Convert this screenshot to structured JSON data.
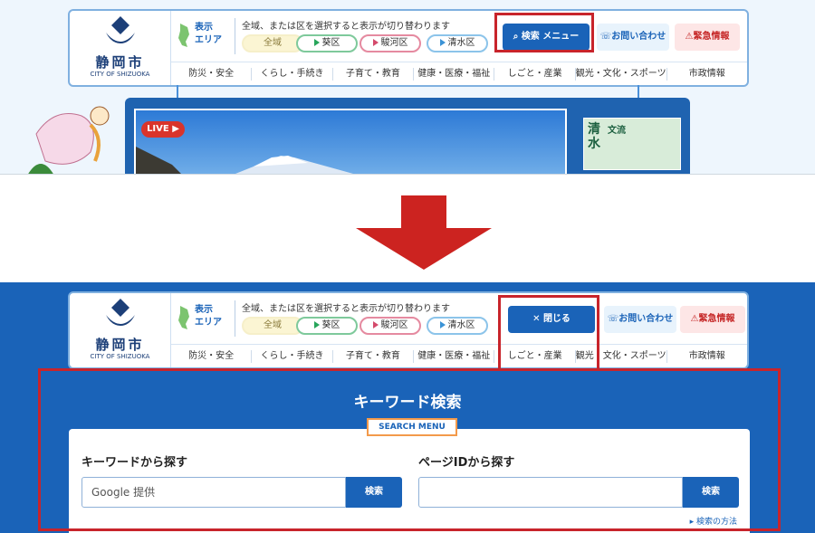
{
  "header": {
    "city_name": "静岡市",
    "city_name_en": "CITY OF SHIZUOKA",
    "area_label": "表示エリア",
    "area_label_line1": "表示",
    "area_label_line2": "エリア",
    "area_description": "全域、または区を選択すると表示が切り替わります",
    "wards": [
      {
        "label": "全域"
      },
      {
        "label": "葵区"
      },
      {
        "label": "駿河区"
      },
      {
        "label": "清水区"
      }
    ],
    "search_menu_label": "検索 メニュー",
    "close_label": "閉じる",
    "contact_label": "お問い合わせ",
    "emergency_label": "緊急情報",
    "nav": [
      {
        "label": "防災・安全"
      },
      {
        "label": "くらし・手続き"
      },
      {
        "label": "子育て・教育"
      },
      {
        "label": "健康・医療・福祉"
      },
      {
        "label": "しごと・産業"
      },
      {
        "label": "観光・文化・スポーツ"
      },
      {
        "label": "市政情報"
      }
    ]
  },
  "hero": {
    "live_label": "LIVE",
    "promo_text_line1": "清",
    "promo_text_line2": "水",
    "promo_title": "文流"
  },
  "search_panel": {
    "title": "キーワード検索",
    "subtitle": "SEARCH MENU",
    "keyword_title": "キーワードから探す",
    "keyword_placeholder": "Google 提供",
    "keyword_button": "検索",
    "page_id_title": "ページIDから探す",
    "page_id_button": "検索",
    "howto_link": "検索の方法"
  },
  "colors": {
    "brand_blue": "#1a63b8",
    "highlight_red": "#c8242b",
    "arrow_red": "#cc2320"
  }
}
